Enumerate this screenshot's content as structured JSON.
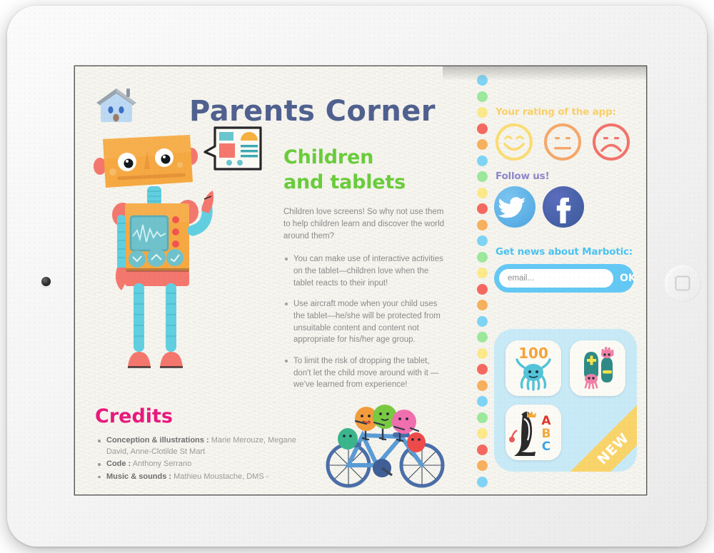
{
  "device": {
    "home_button_icon": "rounded-square-icon",
    "camera_icon": "camera-lens-icon"
  },
  "left_page": {
    "home_icon": "house-icon",
    "title": "Parents Corner",
    "title_color": "#50618f",
    "doc_icon": "document-bubble-icon",
    "robot_icon": "robot-illustration",
    "article": {
      "heading_line1": "Children",
      "heading_line2": "and tablets",
      "heading_color": "#6acc3c",
      "intro": "Children love screens! So why not use them to help children learn and discover the world around them?",
      "bullets": [
        "You can make use of interactive activities on the tablet—children love when the tablet reacts to their input!",
        "Use aircraft mode when your child uses the tablet—he/she will be protected from unsuitable content and content not appropriate for his/her age group.",
        "To limit the risk of dropping the tablet, don't let the child move around with it —we've learned from experience!"
      ]
    },
    "credits": {
      "heading": "Credits",
      "heading_color": "#e8197d",
      "items": [
        {
          "role": "Conception & illustrations :",
          "names": "Marie Merouze, Megane David, Anne-Clotilde St Mart"
        },
        {
          "role": "Code :",
          "names": "Anthony Serrano"
        },
        {
          "role": "Music & sounds :",
          "names": "Mathieu Moustache, DMS -"
        }
      ]
    },
    "bicycle_icon": "bicycle-illustration"
  },
  "spiral": {
    "colors": [
      "#7fd4f5",
      "#9ce89c",
      "#fbe98a",
      "#f4695f",
      "#f7b15e"
    ],
    "count": 26
  },
  "right_page": {
    "rating": {
      "heading": "Your rating of the app:",
      "heading_color": "#fad06a",
      "faces": [
        {
          "name": "smiley-happy-icon",
          "color": "#fbdc72"
        },
        {
          "name": "smiley-neutral-icon",
          "color": "#f5a86a"
        },
        {
          "name": "smiley-sad-icon",
          "color": "#f2736a"
        }
      ]
    },
    "follow": {
      "heading": "Follow us!",
      "heading_color": "#8d86c9",
      "networks": [
        {
          "name": "twitter-icon",
          "color": "#4da3e0"
        },
        {
          "name": "facebook-icon",
          "color": "#3b5998"
        }
      ]
    },
    "newsletter": {
      "heading": "Get news about Marbotic:",
      "heading_color": "#4cc3f0",
      "email_placeholder": "email...",
      "email_value": "",
      "ok_label": "OK",
      "bar_color": "#64c8f5"
    },
    "apps": {
      "panel_color": "#c8eaf7",
      "tiles": [
        {
          "name": "app-tile-100",
          "label": "100",
          "icon": "octopus-icon"
        },
        {
          "name": "app-tile-plus-minus",
          "label": "",
          "icon": "plus-minus-monsters-icon"
        },
        {
          "name": "app-tile-abc",
          "label": "ABC",
          "icon": "penguin-abc-icon"
        }
      ],
      "ribbon_label": "NEW",
      "ribbon_color": "#f8d46a"
    }
  }
}
